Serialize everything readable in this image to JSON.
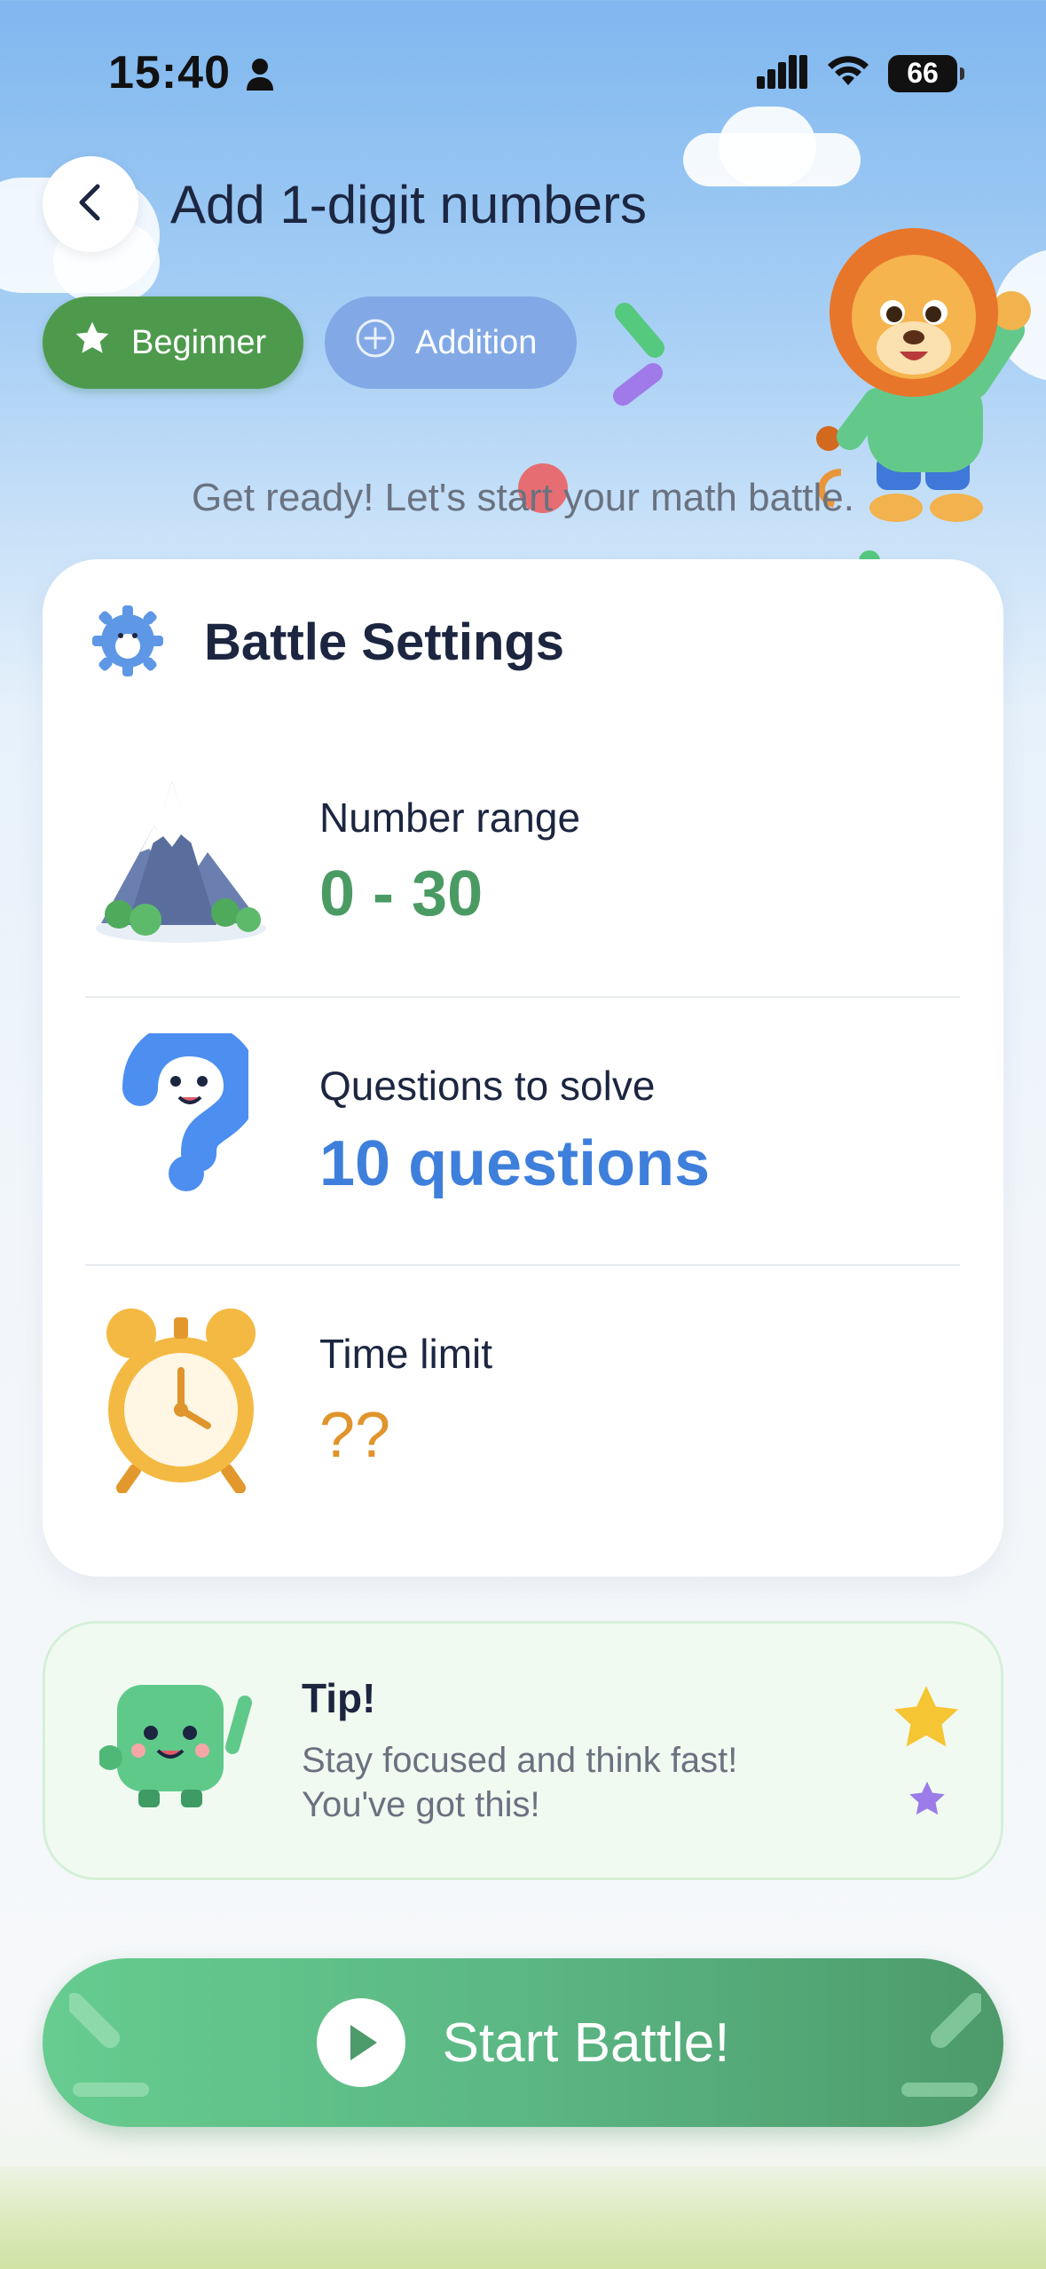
{
  "status_bar": {
    "time": "15:40",
    "battery": "66"
  },
  "header": {
    "title": "Add 1-digit numbers",
    "back_icon": "chevron-left-icon"
  },
  "tags": [
    {
      "label": "Beginner",
      "icon": "star-icon",
      "color": "#4e9a4d"
    },
    {
      "label": "Addition",
      "icon": "plus-circle-icon",
      "color": "#82a9e6"
    }
  ],
  "subtitle": "Get ready! Let's start your math battle.",
  "settings": {
    "title": "Battle Settings",
    "rows": [
      {
        "label": "Number range",
        "value": "0 - 30",
        "color": "#4a9b63",
        "icon": "mountain-icon"
      },
      {
        "label": "Questions to solve",
        "value": "10 questions",
        "color": "#3f7fdc",
        "icon": "question-mark-icon"
      },
      {
        "label": "Time limit",
        "value": "??",
        "color": "#e0942c",
        "icon": "alarm-clock-icon"
      }
    ]
  },
  "tip": {
    "title": "Tip!",
    "line1": "Stay focused and think fast!",
    "line2": "You've got this!"
  },
  "start_button": {
    "label": "Start Battle!"
  }
}
